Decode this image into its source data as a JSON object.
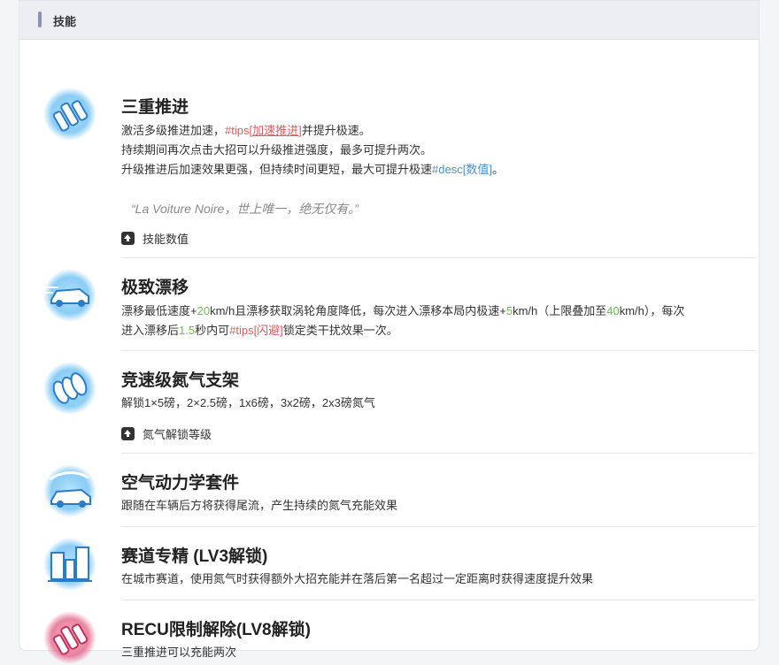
{
  "header": {
    "title": "技能"
  },
  "skills": [
    {
      "title": "三重推进",
      "icon": "triple-boost-icon",
      "lines": [
        [
          "激活多级推进加速，",
          "#tips[",
          "加速推进",
          "]",
          "并提升极速。"
        ],
        [
          "持续期间再次点击大招可以升级推进强度，最多可提升两次。"
        ],
        [
          "升级推进后加速效果更强，但持续时间更短，最大可提升极速",
          "#desc[数值]",
          "。"
        ]
      ],
      "quote": "“La Voiture Noire，世上唯一，绝无仅有。”",
      "expand": "技能数值"
    },
    {
      "title": "极致漂移",
      "icon": "drift-car-icon",
      "line1": [
        "漂移最低速度+",
        "20",
        "km/h且漂移获取涡轮角度降低，每次进入漂移本局内极速+",
        "5",
        "km/h（上限叠加至",
        "40",
        "km/h），每次"
      ],
      "line2": [
        "进入漂移后",
        "1.5",
        "秒内可",
        "#tips[闪避]",
        "锁定类干扰效果一次。"
      ]
    },
    {
      "title": "竞速级氮气支架",
      "icon": "nitro-rack-icon",
      "line": "解锁1×5磅，2×2.5磅，1x6磅，3x2磅，2x3磅氮气",
      "expand": "氮气解锁等级"
    },
    {
      "title": "空气动力学套件",
      "icon": "aero-kit-icon",
      "line": "跟随在车辆后方将获得尾流，产生持续的氮气充能效果"
    },
    {
      "title": "赛道专精 (LV3解锁)",
      "icon": "city-track-icon",
      "line": "在城市赛道，使用氮气时获得额外大招充能并在落后第一名超过一定距离时获得速度提升效果"
    },
    {
      "title": "RECU限制解除(LV8解锁)",
      "icon": "recu-unlock-icon",
      "line": "三重推进可以充能两次"
    }
  ],
  "colors": {
    "tips": "#e05a5a",
    "desc": "#4a8fd0",
    "number": "#6cbf4a",
    "icon_blue": "#3a9be0",
    "icon_pink": "#e0507a"
  }
}
